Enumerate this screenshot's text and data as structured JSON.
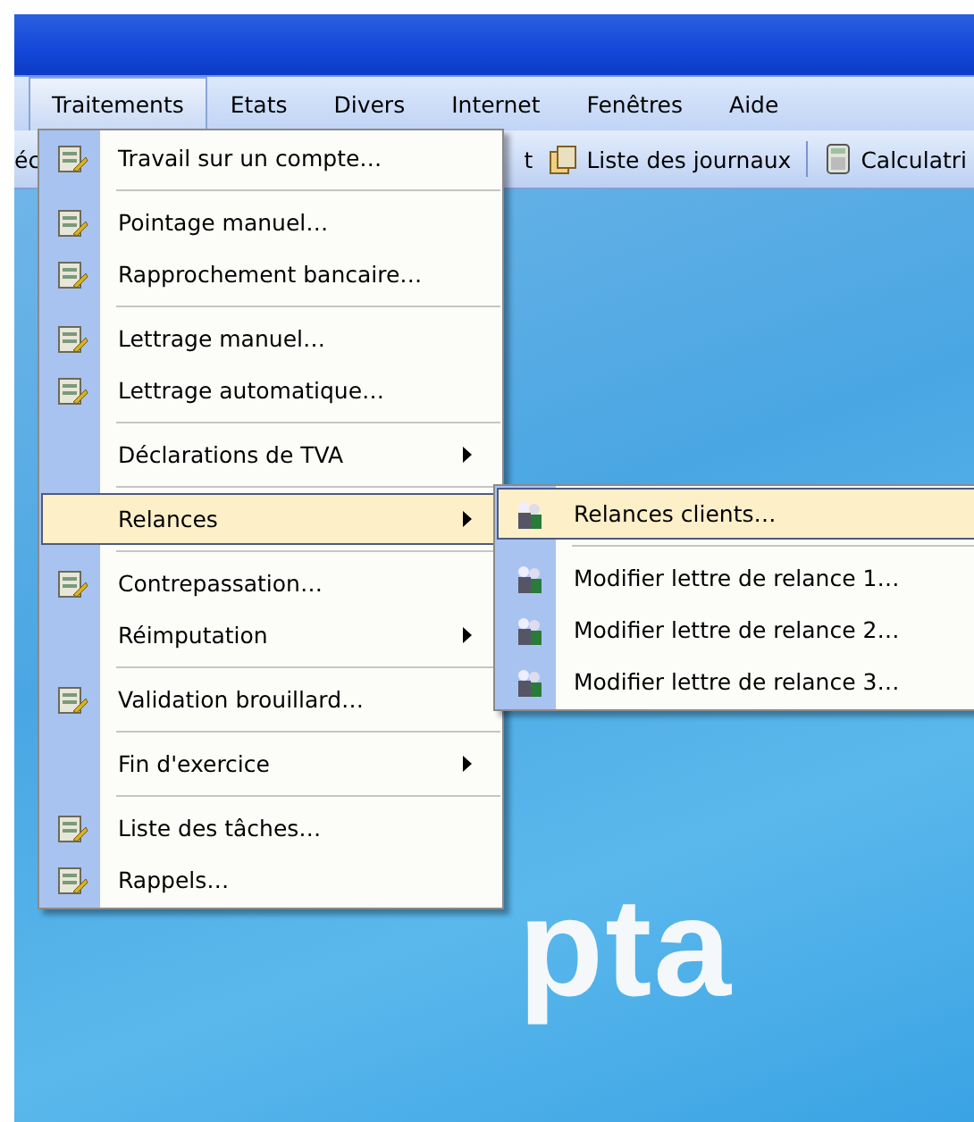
{
  "menu_bar": [
    {
      "label": "Traitements",
      "selected": true
    },
    {
      "label": "Etats",
      "selected": false
    },
    {
      "label": "Divers",
      "selected": false
    },
    {
      "label": "Internet",
      "selected": false
    },
    {
      "label": "Fenêtres",
      "selected": false
    },
    {
      "label": "Aide",
      "selected": false
    }
  ],
  "toolbar": [
    {
      "label": "éc",
      "icon": false
    },
    {
      "label": "t",
      "icon": false
    },
    {
      "label": "Liste des journaux",
      "icon": true
    },
    {
      "label": "Calculatri",
      "icon": true
    }
  ],
  "menu": [
    {
      "kind": "item",
      "label": "Travail sur un compte…",
      "has_icon": true,
      "submenu": false,
      "selected": false
    },
    {
      "kind": "separator"
    },
    {
      "kind": "item",
      "label": "Pointage manuel…",
      "has_icon": true,
      "submenu": false,
      "selected": false
    },
    {
      "kind": "item",
      "label": "Rapprochement bancaire…",
      "has_icon": true,
      "submenu": false,
      "selected": false
    },
    {
      "kind": "separator"
    },
    {
      "kind": "item",
      "label": "Lettrage manuel…",
      "has_icon": true,
      "submenu": false,
      "selected": false
    },
    {
      "kind": "item",
      "label": "Lettrage automatique…",
      "has_icon": true,
      "submenu": false,
      "selected": false
    },
    {
      "kind": "separator"
    },
    {
      "kind": "item",
      "label": "Déclarations de TVA",
      "has_icon": false,
      "submenu": true,
      "selected": false
    },
    {
      "kind": "separator"
    },
    {
      "kind": "item",
      "label": "Relances",
      "has_icon": false,
      "submenu": true,
      "selected": true
    },
    {
      "kind": "separator"
    },
    {
      "kind": "item",
      "label": "Contrepassation…",
      "has_icon": true,
      "submenu": false,
      "selected": false
    },
    {
      "kind": "item",
      "label": "Réimputation",
      "has_icon": false,
      "submenu": true,
      "selected": false
    },
    {
      "kind": "separator"
    },
    {
      "kind": "item",
      "label": "Validation brouillard…",
      "has_icon": true,
      "submenu": false,
      "selected": false
    },
    {
      "kind": "separator"
    },
    {
      "kind": "item",
      "label": "Fin d'exercice",
      "has_icon": false,
      "submenu": true,
      "selected": false
    },
    {
      "kind": "separator"
    },
    {
      "kind": "item",
      "label": "Liste des tâches…",
      "has_icon": true,
      "submenu": false,
      "selected": false
    },
    {
      "kind": "item",
      "label": "Rappels…",
      "has_icon": true,
      "submenu": false,
      "selected": false
    }
  ],
  "submenu": [
    {
      "kind": "item",
      "label": "Relances clients…",
      "has_icon": true,
      "submenu": false,
      "selected": true
    },
    {
      "kind": "separator"
    },
    {
      "kind": "item",
      "label": "Modifier lettre de relance 1…",
      "has_icon": true,
      "submenu": false,
      "selected": false
    },
    {
      "kind": "item",
      "label": "Modifier lettre de relance 2…",
      "has_icon": true,
      "submenu": false,
      "selected": false
    },
    {
      "kind": "item",
      "label": "Modifier lettre de relance 3…",
      "has_icon": true,
      "submenu": false,
      "selected": false
    }
  ],
  "logo_text": "pta"
}
